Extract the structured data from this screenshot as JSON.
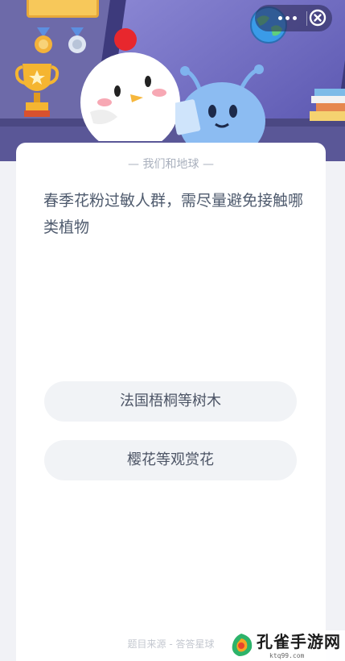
{
  "header": {
    "menu_icon": "more-dots-icon",
    "close_icon": "close-circle-icon"
  },
  "card": {
    "title": "— 我们和地球 —",
    "question": "春季花粉过敏人群，需尽量避免接触哪类植物",
    "options": [
      {
        "label": "法国梧桐等树木"
      },
      {
        "label": "樱花等观赏花"
      }
    ],
    "source": "题目来源 - 答答星球"
  },
  "watermark": {
    "name": "孔雀手游网",
    "url": "ktq99.com"
  },
  "colors": {
    "hero_bg": "#6d6aa9",
    "option_bg": "#f1f3f6",
    "question_text": "#4f5b6e"
  }
}
